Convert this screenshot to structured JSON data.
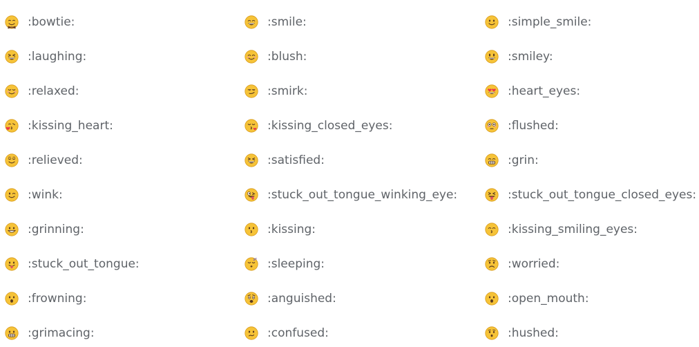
{
  "columns": [
    {
      "items": [
        {
          "code": ":bowtie:",
          "icon": "bowtie-icon"
        },
        {
          "code": ":laughing:",
          "icon": "laughing-face-icon"
        },
        {
          "code": ":relaxed:",
          "icon": "relaxed-face-icon"
        },
        {
          "code": ":kissing_heart:",
          "icon": "kissing-heart-face-icon"
        },
        {
          "code": ":relieved:",
          "icon": "relieved-face-icon"
        },
        {
          "code": ":wink:",
          "icon": "wink-face-icon"
        },
        {
          "code": ":grinning:",
          "icon": "grinning-face-icon"
        },
        {
          "code": ":stuck_out_tongue:",
          "icon": "stuck-out-tongue-face-icon"
        },
        {
          "code": ":frowning:",
          "icon": "frowning-face-icon"
        },
        {
          "code": ":grimacing:",
          "icon": "grimacing-face-icon"
        }
      ]
    },
    {
      "items": [
        {
          "code": ":smile:",
          "icon": "smile-face-icon"
        },
        {
          "code": ":blush:",
          "icon": "blush-face-icon"
        },
        {
          "code": ":smirk:",
          "icon": "smirk-face-icon"
        },
        {
          "code": ":kissing_closed_eyes:",
          "icon": "kissing-closed-eyes-face-icon"
        },
        {
          "code": ":satisfied:",
          "icon": "satisfied-face-icon"
        },
        {
          "code": ":stuck_out_tongue_winking_eye:",
          "icon": "stuck-out-tongue-winking-eye-face-icon"
        },
        {
          "code": ":kissing:",
          "icon": "kissing-face-icon"
        },
        {
          "code": ":sleeping:",
          "icon": "sleeping-face-icon"
        },
        {
          "code": ":anguished:",
          "icon": "anguished-face-icon"
        },
        {
          "code": ":confused:",
          "icon": "confused-face-icon"
        }
      ]
    },
    {
      "items": [
        {
          "code": ":simple_smile:",
          "icon": "simple-smile-face-icon"
        },
        {
          "code": ":smiley:",
          "icon": "smiley-face-icon"
        },
        {
          "code": ":heart_eyes:",
          "icon": "heart-eyes-face-icon"
        },
        {
          "code": ":flushed:",
          "icon": "flushed-face-icon"
        },
        {
          "code": ":grin:",
          "icon": "grin-face-icon"
        },
        {
          "code": ":stuck_out_tongue_closed_eyes:",
          "icon": "stuck-out-tongue-closed-eyes-face-icon"
        },
        {
          "code": ":kissing_smiling_eyes:",
          "icon": "kissing-smiling-eyes-face-icon"
        },
        {
          "code": ":worried:",
          "icon": "worried-face-icon"
        },
        {
          "code": ":open_mouth:",
          "icon": "open-mouth-face-icon"
        },
        {
          "code": ":hushed:",
          "icon": "hushed-face-icon"
        }
      ]
    }
  ],
  "colors": {
    "face": "#f6c338",
    "face_edge": "#d79a1b",
    "feature": "#5a3a1f",
    "tongue": "#e0525f",
    "heart": "#ea3646",
    "cheek": "#f39aa1",
    "text": "#5f6368"
  }
}
